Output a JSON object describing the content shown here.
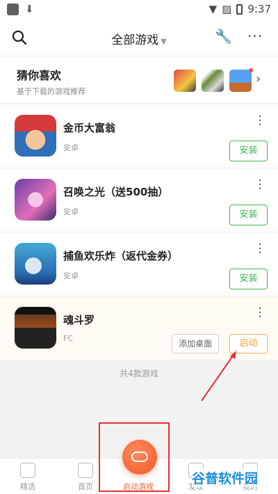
{
  "status_bar": {
    "time": "9:37"
  },
  "header": {
    "title": "全部游戏"
  },
  "recommend": {
    "title": "猜你喜欢",
    "subtitle": "基于下载的游戏推荐"
  },
  "games": [
    {
      "name": "金币大富翁",
      "platform": "安卓",
      "action": "安装"
    },
    {
      "name": "召唤之光（送500抽）",
      "platform": "安卓",
      "action": "安装"
    },
    {
      "name": "捕鱼欢乐炸（返代金券）",
      "platform": "安卓",
      "action": "安装"
    },
    {
      "name": "魂斗罗",
      "platform": "FC",
      "secondary_action": "添加桌面",
      "action": "启动"
    }
  ],
  "count_text": "共4款游戏",
  "bottom_nav": [
    {
      "label": "精选"
    },
    {
      "label": "首页"
    },
    {
      "label": "启动游戏"
    },
    {
      "label": "发现"
    },
    {
      "label": "我的"
    }
  ],
  "watermark": "谷普软件园"
}
